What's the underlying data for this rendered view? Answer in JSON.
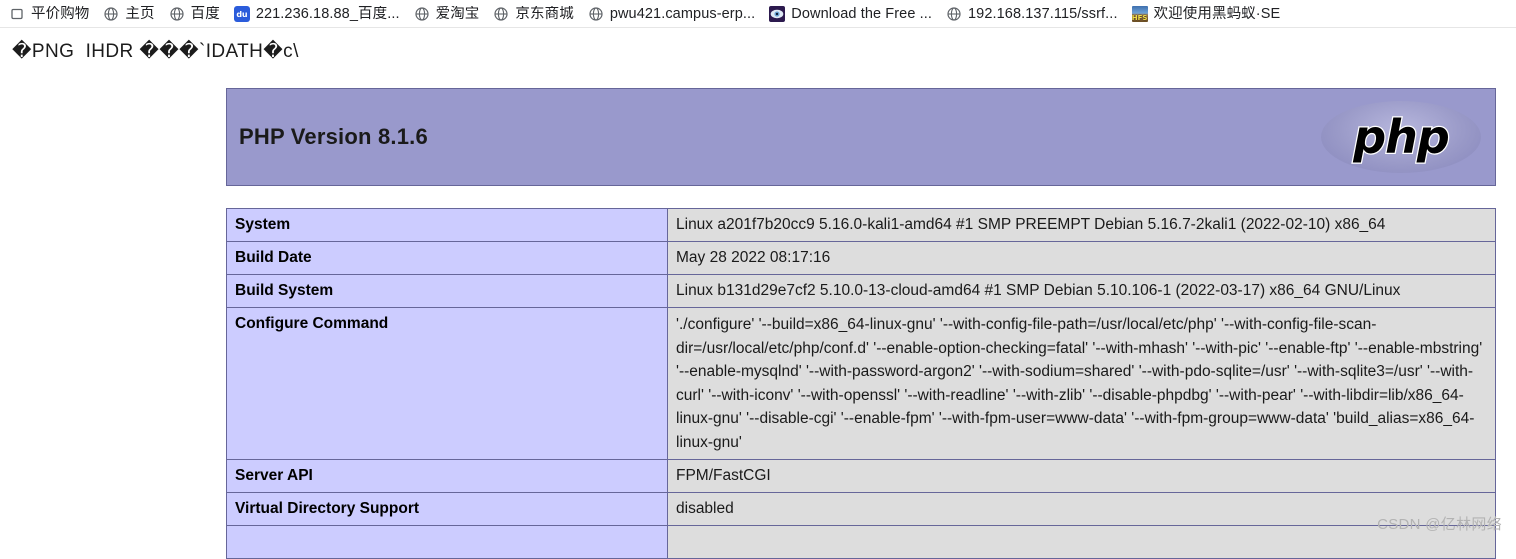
{
  "bookmarks_bar": {
    "items": [
      {
        "label": "平价购物",
        "icon": "bookmark-outline-icon"
      },
      {
        "label": "主页",
        "icon": "globe-icon"
      },
      {
        "label": "百度",
        "icon": "globe-icon"
      },
      {
        "label": "221.236.18.88_百度...",
        "icon": "baidu-icon"
      },
      {
        "label": "爱淘宝",
        "icon": "globe-icon"
      },
      {
        "label": "京东商城",
        "icon": "globe-icon"
      },
      {
        "label": "pwu421.campus-erp...",
        "icon": "globe-icon"
      },
      {
        "label": "Download the Free ...",
        "icon": "eye-icon"
      },
      {
        "label": "192.168.137.115/ssrf...",
        "icon": "globe-icon"
      },
      {
        "label": "欢迎使用黑蚂蚁·SE",
        "icon": "hfs-icon"
      }
    ]
  },
  "png_text": {
    "line": "�PNG  IHDR ���`IDATH�c\\"
  },
  "phpinfo": {
    "header": {
      "version_title": "PHP Version 8.1.6",
      "logo_text": "php",
      "header_bg": "#9999cc",
      "border_color": "#666699"
    },
    "table": {
      "label_bg": "#ccccff",
      "value_bg": "#dddddd",
      "rows": [
        {
          "label": "System",
          "value": "Linux a201f7b20cc9 5.16.0-kali1-amd64 #1 SMP PREEMPT Debian 5.16.7-2kali1 (2022-02-10) x86_64"
        },
        {
          "label": "Build Date",
          "value": "May 28 2022 08:17:16"
        },
        {
          "label": "Build System",
          "value": "Linux b131d29e7cf2 5.10.0-13-cloud-amd64 #1 SMP Debian 5.10.106-1 (2022-03-17) x86_64 GNU/Linux"
        },
        {
          "label": "Configure Command",
          "value": "'./configure'  '--build=x86_64-linux-gnu' '--with-config-file-path=/usr/local/etc/php' '--with-config-file-scan-dir=/usr/local/etc/php/conf.d' '--enable-option-checking=fatal' '--with-mhash' '--with-pic' '--enable-ftp' '--enable-mbstring' '--enable-mysqlnd' '--with-password-argon2' '--with-sodium=shared' '--with-pdo-sqlite=/usr' '--with-sqlite3=/usr' '--with-curl' '--with-iconv' '--with-openssl' '--with-readline' '--with-zlib' '--disable-phpdbg' '--with-pear' '--with-libdir=lib/x86_64-linux-gnu' '--disable-cgi' '--enable-fpm' '--with-fpm-user=www-data' '--with-fpm-group=www-data' 'build_alias=x86_64-linux-gnu'"
        },
        {
          "label": "Server API",
          "value": "FPM/FastCGI"
        },
        {
          "label": "Virtual Directory Support",
          "value": "disabled"
        },
        {
          "label": "",
          "value": ""
        }
      ]
    }
  },
  "watermark": {
    "text": "CSDN @亿林网络"
  }
}
